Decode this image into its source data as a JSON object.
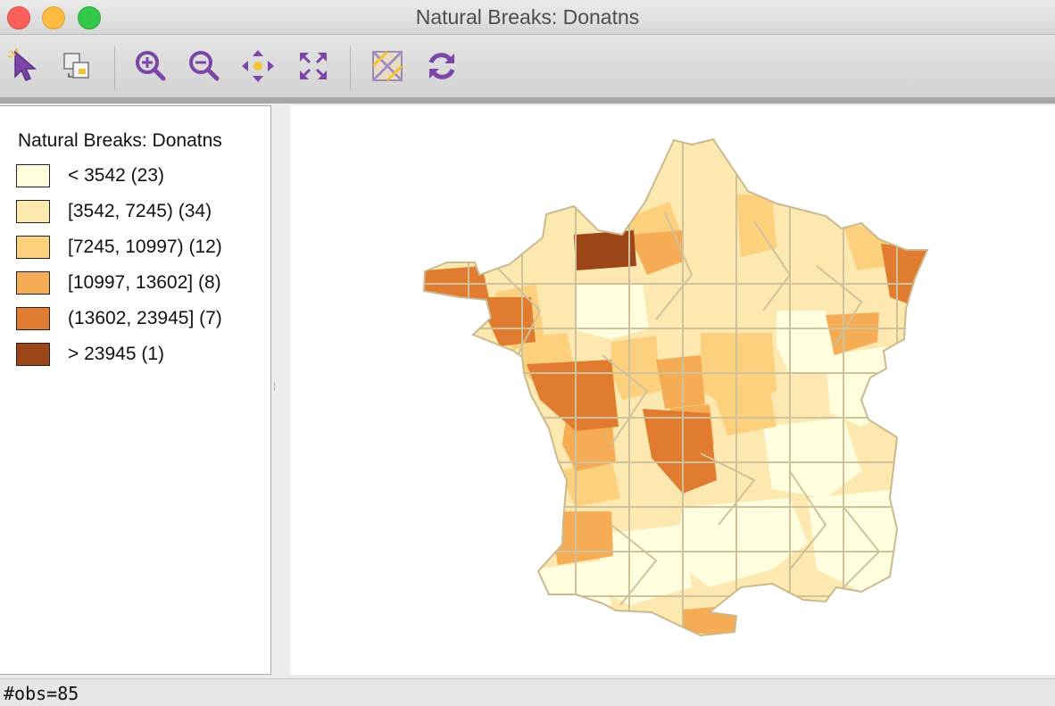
{
  "window": {
    "title": "Natural Breaks: Donatns"
  },
  "toolbar": {
    "tools": [
      {
        "name": "select-tool",
        "icon": "pointer-icon"
      },
      {
        "name": "copy-selection-tool",
        "icon": "copy-image-icon"
      },
      {
        "name": "zoom-in-tool",
        "icon": "zoom-in-icon"
      },
      {
        "name": "zoom-out-icon-tool",
        "icon": "zoom-out-icon"
      },
      {
        "name": "pan-tool",
        "icon": "pan-arrows-icon"
      },
      {
        "name": "fit-extent-tool",
        "icon": "fit-extent-icon"
      },
      {
        "name": "basemap-tool",
        "icon": "basemap-icon"
      },
      {
        "name": "refresh-tool",
        "icon": "refresh-icon"
      }
    ]
  },
  "legend": {
    "title": "Natural Breaks: Donatns",
    "items": [
      {
        "label": "< 3542 (23)",
        "color": "#ffffe0"
      },
      {
        "label": "[3542, 7245) (34)",
        "color": "#fde8b0"
      },
      {
        "label": "[7245, 10997) (12)",
        "color": "#fcd07c"
      },
      {
        "label": "[10997, 13602] (8)",
        "color": "#f5ac55"
      },
      {
        "label": "(13602, 23945] (7)",
        "color": "#e07b30"
      },
      {
        "label": "> 23945 (1)",
        "color": "#9c4519"
      }
    ]
  },
  "map": {
    "region": "France departments",
    "border_color": "#cfc29a"
  },
  "status": {
    "text": "#obs=85"
  }
}
